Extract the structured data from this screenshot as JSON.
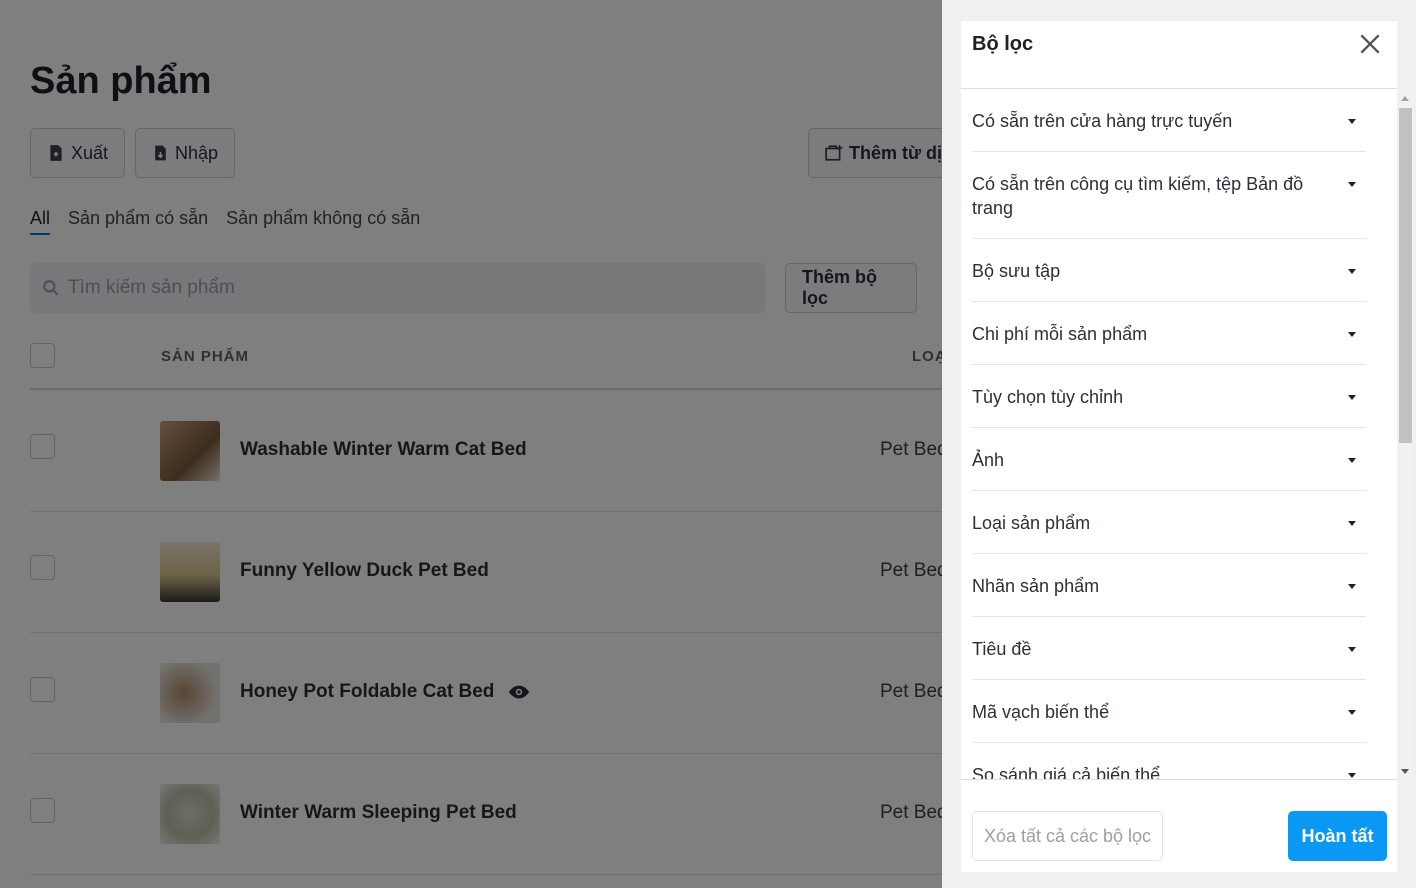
{
  "page": {
    "title": "Sản phẩm",
    "export_label": "Xuất",
    "import_label": "Nhập",
    "add_from_label": "Thêm từ dị",
    "tabs": [
      "All",
      "Sản phẩm có sẵn",
      "Sản phẩm không có sẵn"
    ],
    "search_placeholder": "Tìm kiếm sản phẩm",
    "add_filter_label": "Thêm bộ lọc",
    "columns": {
      "product": "SẢN PHẨM",
      "type": "LOẠ"
    },
    "rows": [
      {
        "name": "Washable Winter Warm Cat Bed",
        "type": "Pet Bed"
      },
      {
        "name": "Funny Yellow Duck Pet Bed",
        "type": "Pet Bed"
      },
      {
        "name": "Honey Pot Foldable Cat Bed",
        "type": "Pet Bed",
        "icon": "eye-icon"
      },
      {
        "name": "Winter Warm Sleeping Pet Bed",
        "type": "Pet Bed"
      }
    ]
  },
  "filter_panel": {
    "title": "Bộ lọc",
    "items": [
      "Có sẵn trên cửa hàng trực tuyến",
      "Có sẵn trên công cụ tìm kiếm, tệp Bản đồ trang",
      "Bộ sưu tập",
      "Chi phí mỗi sản phẩm",
      "Tùy chọn tùy chỉnh",
      "Ảnh",
      "Loại sản phẩm",
      "Nhãn sản phẩm",
      "Tiêu đề",
      "Mã vạch biến thể",
      "So sánh giá cả biến thể"
    ],
    "clear_label": "Xóa tất cả các bộ lọc",
    "done_label": "Hoàn tất"
  },
  "colors": {
    "accent": "#0a98f2",
    "tab_underline": "#0b74c9"
  }
}
